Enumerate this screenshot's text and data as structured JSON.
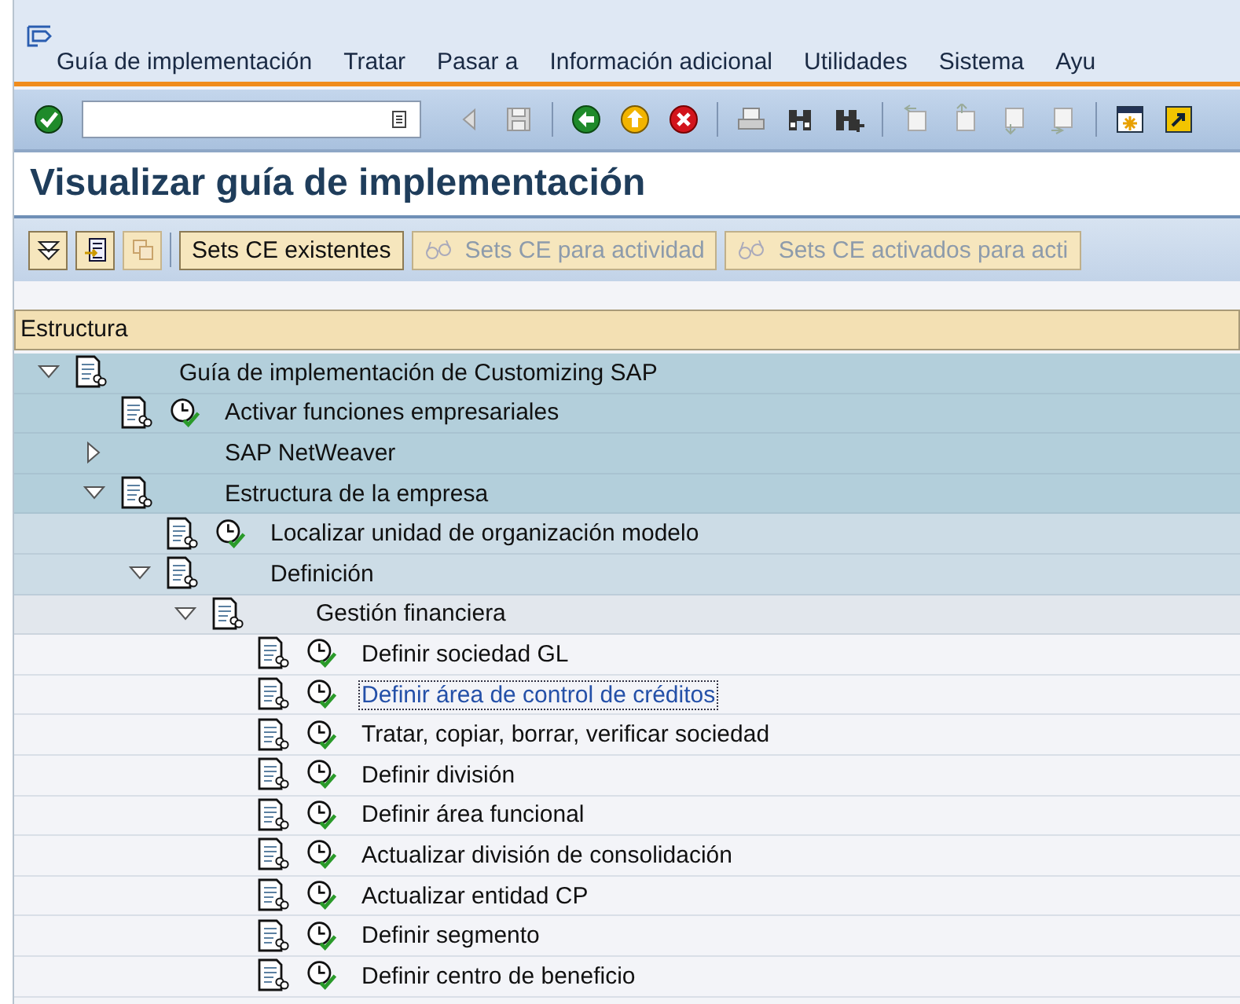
{
  "menu_bar": {
    "items": [
      "Guía de implementación",
      "Tratar",
      "Pasar a",
      "Información adicional",
      "Utilidades",
      "Sistema",
      "Ayu"
    ]
  },
  "title": "Visualizar guía de implementación",
  "app_toolbar": {
    "buttons": [
      {
        "label": "Sets CE existentes",
        "disabled": false
      },
      {
        "label": "Sets CE para actividad",
        "disabled": true
      },
      {
        "label": "Sets CE activados para acti",
        "disabled": true
      }
    ]
  },
  "tree": {
    "header": "Estructura",
    "nodes": [
      {
        "label": "Guía de implementación de Customizing SAP",
        "kind": "branch",
        "expanded": true,
        "document": true,
        "activity": false,
        "selected": false,
        "children": [
          {
            "label": "Activar funciones empresariales",
            "kind": "leaf",
            "document": true,
            "activity": true,
            "selected": false
          },
          {
            "label": "SAP NetWeaver",
            "kind": "branch",
            "expanded": false,
            "document": false,
            "activity": false,
            "selected": false
          },
          {
            "label": "Estructura de la empresa",
            "kind": "branch",
            "expanded": true,
            "document": true,
            "activity": false,
            "selected": false,
            "children": [
              {
                "label": "Localizar unidad de organización modelo",
                "kind": "leaf",
                "document": true,
                "activity": true,
                "selected": false
              },
              {
                "label": "Definición",
                "kind": "branch",
                "expanded": true,
                "document": true,
                "activity": false,
                "selected": false,
                "children": [
                  {
                    "label": "Gestión financiera",
                    "kind": "branch",
                    "expanded": true,
                    "document": true,
                    "activity": false,
                    "selected": false,
                    "children": [
                      {
                        "label": "Definir sociedad GL",
                        "kind": "leaf",
                        "document": true,
                        "activity": true,
                        "selected": false
                      },
                      {
                        "label": "Definir área de control de créditos",
                        "kind": "leaf",
                        "document": true,
                        "activity": true,
                        "selected": true
                      },
                      {
                        "label": "Tratar, copiar, borrar, verificar sociedad",
                        "kind": "leaf",
                        "document": true,
                        "activity": true,
                        "selected": false
                      },
                      {
                        "label": "Definir división",
                        "kind": "leaf",
                        "document": true,
                        "activity": true,
                        "selected": false
                      },
                      {
                        "label": "Definir área funcional",
                        "kind": "leaf",
                        "document": true,
                        "activity": true,
                        "selected": false
                      },
                      {
                        "label": "Actualizar división de consolidación",
                        "kind": "leaf",
                        "document": true,
                        "activity": true,
                        "selected": false
                      },
                      {
                        "label": "Actualizar entidad CP",
                        "kind": "leaf",
                        "document": true,
                        "activity": true,
                        "selected": false
                      },
                      {
                        "label": "Definir segmento",
                        "kind": "leaf",
                        "document": true,
                        "activity": true,
                        "selected": false
                      },
                      {
                        "label": "Definir centro de beneficio",
                        "kind": "leaf",
                        "document": true,
                        "activity": true,
                        "selected": false
                      }
                    ]
                  }
                ]
              }
            ]
          }
        ]
      }
    ]
  }
}
